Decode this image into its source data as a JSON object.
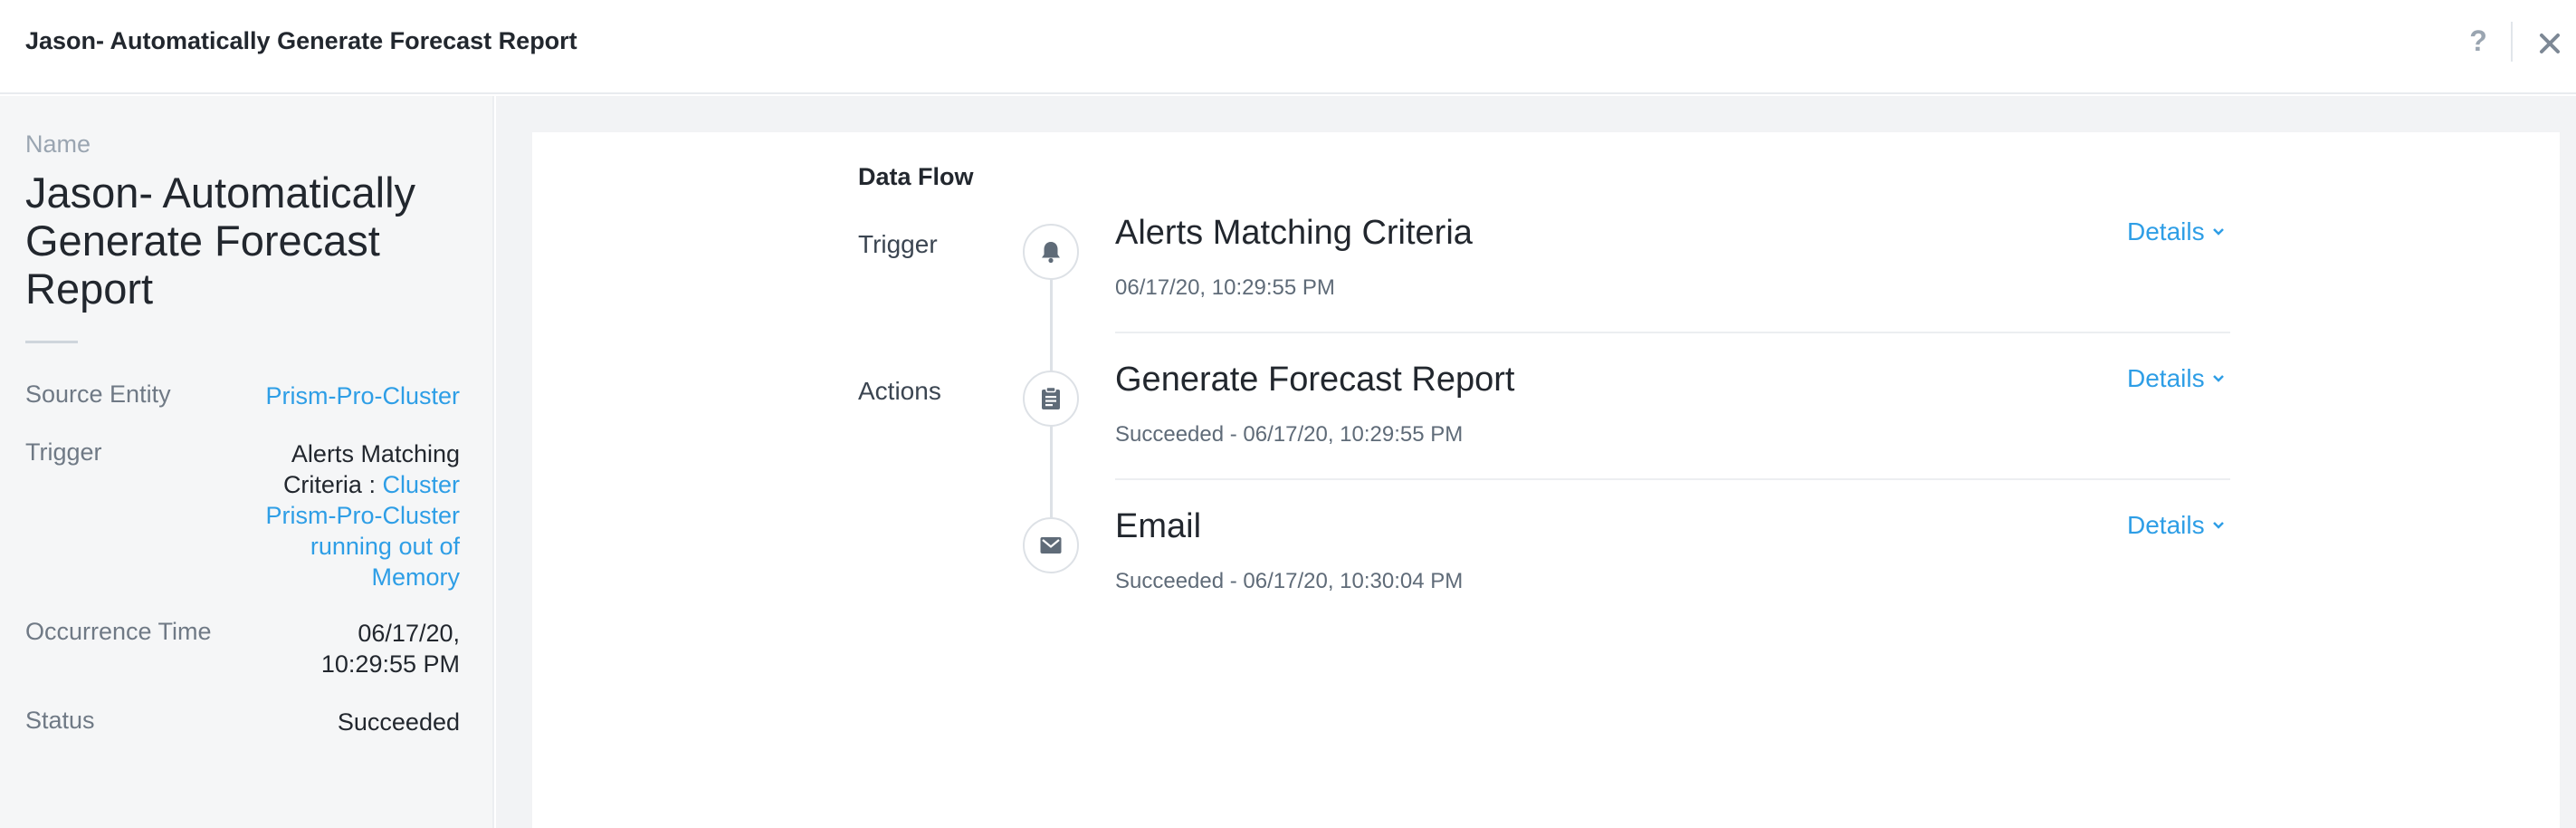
{
  "header": {
    "title": "Jason- Automatically Generate Forecast Report",
    "help_icon": "question-mark-icon",
    "close_icon": "close-icon"
  },
  "sidebar": {
    "name_label": "Name",
    "name_value": "Jason- Automatically Generate Forecast Report",
    "source_entity": {
      "key": "Source Entity",
      "value": "Prism-Pro-Cluster"
    },
    "trigger": {
      "key": "Trigger",
      "value_prefix": "Alerts Matching Criteria : ",
      "value_link": "Cluster Prism-Pro-Cluster running out of Memory"
    },
    "occurrence_time": {
      "key": "Occurrence Time",
      "value": "06/17/20, 10:29:55 PM"
    },
    "status": {
      "key": "Status",
      "value": "Succeeded"
    }
  },
  "data_flow": {
    "title": "Data Flow",
    "trigger_label": "Trigger",
    "actions_label": "Actions",
    "steps": [
      {
        "title": "Alerts Matching Criteria",
        "subtitle": "06/17/20, 10:29:55 PM",
        "details": "Details",
        "icon": "bell-icon"
      },
      {
        "title": "Generate Forecast Report",
        "subtitle": "Succeeded - 06/17/20, 10:29:55 PM",
        "details": "Details",
        "icon": "clipboard-icon"
      },
      {
        "title": "Email",
        "subtitle": "Succeeded - 06/17/20, 10:30:04 PM",
        "details": "Details",
        "icon": "envelope-icon"
      }
    ]
  },
  "colors": {
    "accent": "#2e9ee6",
    "text": "#22272e",
    "muted": "#6f7985",
    "icon": "#5f6b78"
  }
}
